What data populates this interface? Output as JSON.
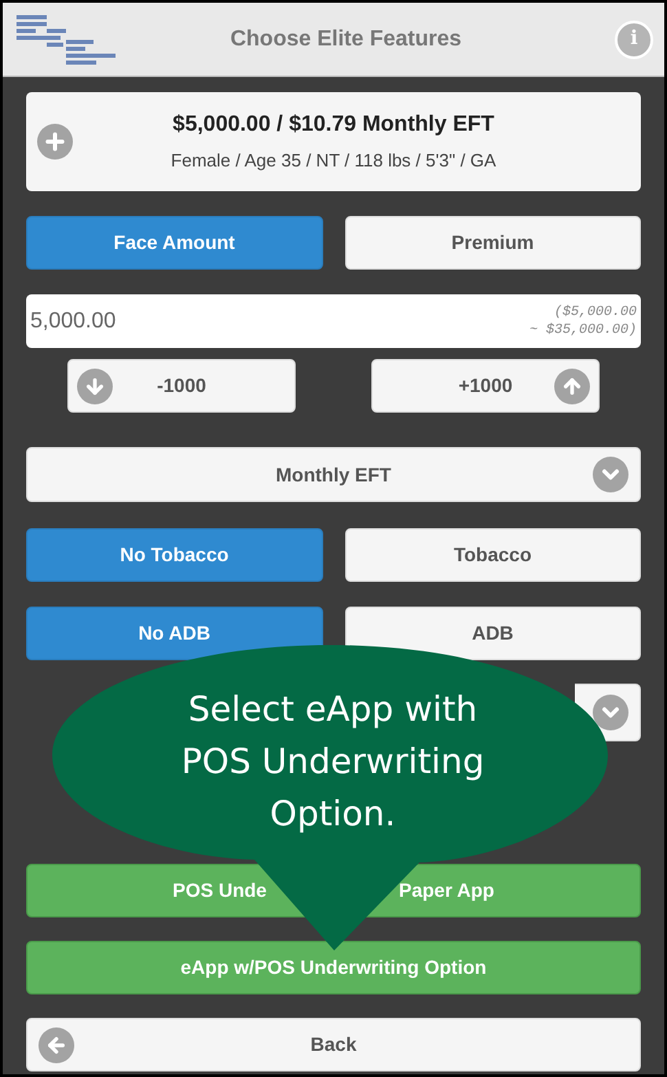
{
  "header": {
    "title": "Choose Elite Features",
    "info_icon": "i"
  },
  "summary": {
    "title": "$5,000.00 / $10.79 Monthly EFT",
    "subtitle": "Female / Age 35 / NT / 118 lbs / 5'3\" / GA"
  },
  "amount_mode": [
    {
      "label": "Face Amount",
      "selected": true
    },
    {
      "label": "Premium",
      "selected": false
    }
  ],
  "amount_field": {
    "value": "5,000.00",
    "range_lines": [
      "($5,000.00",
      "~ $35,000.00)"
    ]
  },
  "steppers": [
    {
      "label": "-1000",
      "kind": "down"
    },
    {
      "label": "+1000",
      "kind": "up"
    }
  ],
  "payment_select": {
    "value": "Monthly EFT"
  },
  "tobacco": [
    {
      "label": "No Tobacco",
      "selected": true
    },
    {
      "label": "Tobacco",
      "selected": false
    }
  ],
  "adb": [
    {
      "label": "No ADB",
      "selected": true
    },
    {
      "label": "ADB",
      "selected": false
    }
  ],
  "actions": [
    {
      "label_parts": [
        "POS Unde",
        "Paper App"
      ]
    },
    {
      "label_parts": [
        "eApp w/POS Underwriting Option"
      ]
    }
  ],
  "back_button": {
    "label": "Back"
  },
  "callout": {
    "lines": [
      "Select eApp with",
      "POS Underwriting",
      "Option."
    ]
  }
}
